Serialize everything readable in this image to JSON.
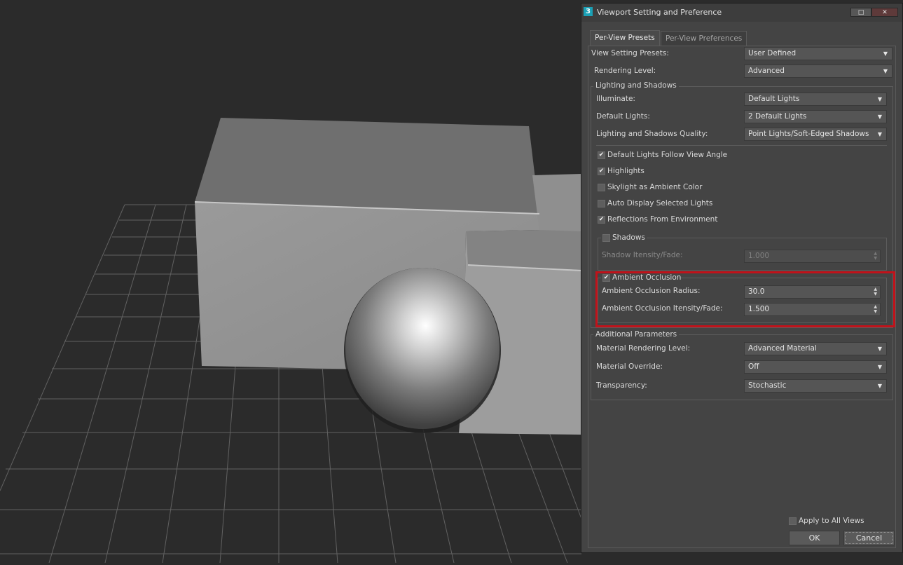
{
  "dialog": {
    "title": "Viewport Setting and Preference",
    "app_icon_text": "3",
    "tabs": [
      {
        "label": "Per-View Presets",
        "active": true
      },
      {
        "label": "Per-View Preferences",
        "active": false
      }
    ],
    "view_setting_presets": {
      "label": "View Setting Presets:",
      "value": "User Defined"
    },
    "rendering_level": {
      "label": "Rendering Level:",
      "value": "Advanced"
    },
    "lighting_and_shadows": {
      "title": "Lighting and Shadows",
      "illuminate": {
        "label": "Illuminate:",
        "value": "Default Lights"
      },
      "default_lights": {
        "label": "Default Lights:",
        "value": "2 Default Lights"
      },
      "quality": {
        "label": "Lighting and Shadows Quality:",
        "value": "Point Lights/Soft-Edged Shadows"
      },
      "checkboxes": [
        {
          "label": "Default Lights Follow View Angle",
          "checked": true
        },
        {
          "label": "Highlights",
          "checked": true
        },
        {
          "label": "Skylight as Ambient Color",
          "checked": false
        },
        {
          "label": "Auto Display Selected Lights",
          "checked": false
        },
        {
          "label": "Reflections From Environment",
          "checked": true
        }
      ],
      "shadows": {
        "label": "Shadows",
        "checked": false,
        "intensity_label": "Shadow Itensity/Fade:",
        "intensity_value": "1.000"
      },
      "ambient_occlusion": {
        "label": "Ambient Occlusion",
        "checked": true,
        "radius_label": "Ambient Occlusion Radius:",
        "radius_value": "30.0",
        "intensity_label": "Ambient Occlusion Itensity/Fade:",
        "intensity_value": "1.500"
      }
    },
    "additional_parameters": {
      "title": "Additional Parameters",
      "material_rendering_level": {
        "label": "Material Rendering Level:",
        "value": "Advanced Material"
      },
      "material_override": {
        "label": "Material Override:",
        "value": "Off"
      },
      "transparency": {
        "label": "Transparency:",
        "value": "Stochastic"
      }
    },
    "apply_to_all_views": {
      "label": "Apply to All Views",
      "checked": false
    },
    "ok_label": "OK",
    "cancel_label": "Cancel"
  },
  "icons": {
    "check": "✔",
    "dropdown": "▼",
    "spinner": "▲▼"
  },
  "colors": {
    "viewport_bg": "#2b2b2b",
    "dialog_bg": "#444444",
    "highlight": "#c1121a",
    "app_icon": "#1ba0b5"
  }
}
